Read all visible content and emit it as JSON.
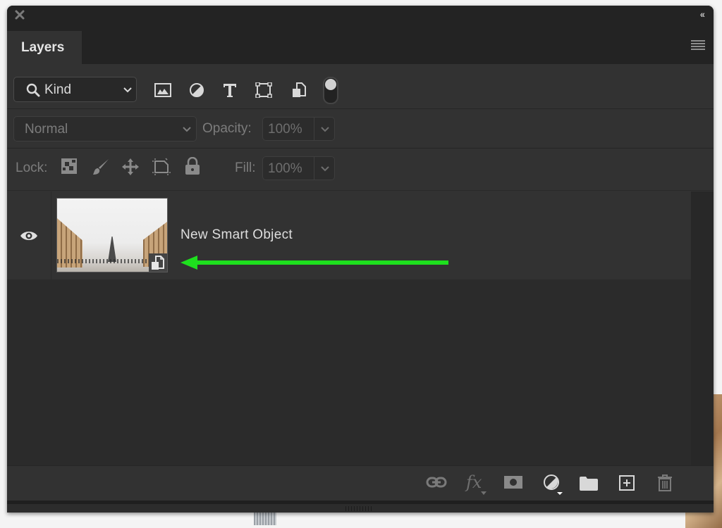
{
  "panel": {
    "close_icon": "close-x-icon",
    "collapse_icon": "double-chevron-left-icon",
    "collapse_label": "‹‹",
    "menu_icon": "hamburger-menu-icon"
  },
  "tabs": [
    {
      "label": "Layers",
      "active": true
    }
  ],
  "filter": {
    "kind_label": "Kind",
    "kind_icon": "search-icon",
    "filter_icons": [
      "image-filter-icon",
      "adjustment-filter-icon",
      "type-filter-icon",
      "shape-filter-icon",
      "smart-object-filter-icon"
    ],
    "type_glyph": "T",
    "toggle_on": true
  },
  "blend": {
    "mode": "Normal",
    "opacity_label": "Opacity:",
    "opacity_value": "100%"
  },
  "lock": {
    "label": "Lock:",
    "icons": [
      "lock-transparent-pixels-icon",
      "lock-image-pixels-icon",
      "lock-position-icon",
      "lock-artboard-icon",
      "lock-all-icon"
    ],
    "fill_label": "Fill:",
    "fill_value": "100%"
  },
  "layers": [
    {
      "name": "New Smart Object",
      "visible": true,
      "type": "smart-object",
      "thumbnail": "Eiffel Tower view from Trocadéro"
    }
  ],
  "annotation": {
    "arrow_color": "#1ee01e",
    "points_to": "smart-object-badge"
  },
  "footer": {
    "icons": [
      "link-layers-icon",
      "fx-icon",
      "layer-mask-icon",
      "adjustment-layer-icon",
      "group-folder-icon",
      "new-layer-icon",
      "trash-icon"
    ],
    "fx_label": "fx"
  },
  "colors": {
    "panel_bg": "#323232",
    "header_bg": "#232323",
    "text_primary": "#dedede",
    "text_dim": "#7c7c7c"
  }
}
